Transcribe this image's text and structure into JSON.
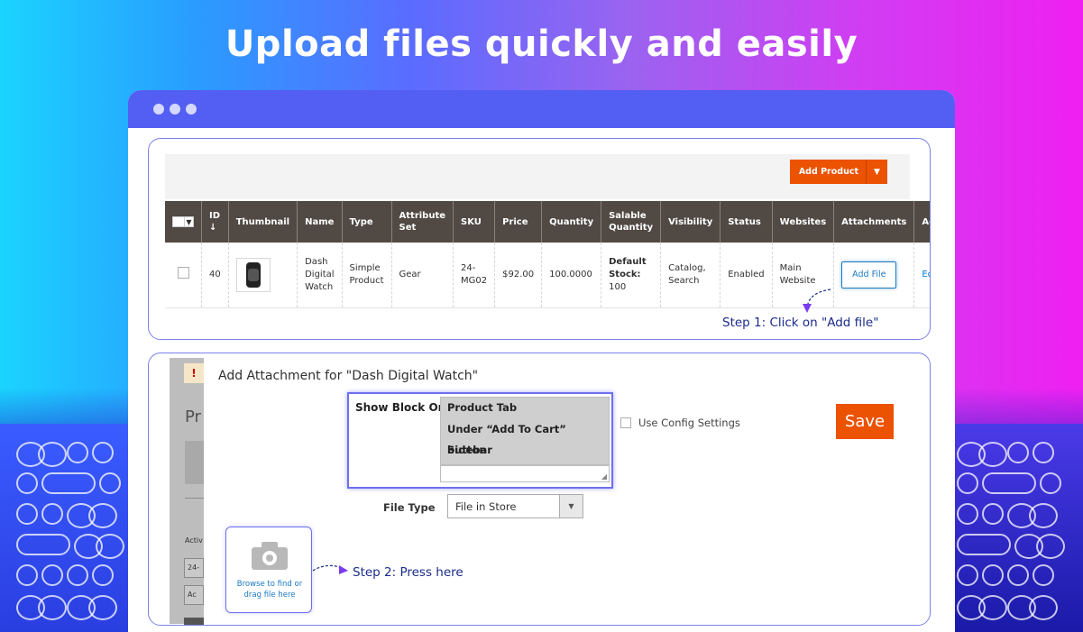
{
  "headline": "Upload files quickly and easily",
  "colors": {
    "accent": "#535ef2",
    "magento_orange": "#eb5202",
    "grid_header": "#514943",
    "step_text": "#1a2a8a"
  },
  "grid": {
    "add_product_label": "Add Product",
    "columns": [
      "ID ↓",
      "Thumbnail",
      "Name",
      "Type",
      "Attribute Set",
      "SKU",
      "Price",
      "Quantity",
      "Salable Quantity",
      "Visibility",
      "Status",
      "Websites",
      "Attachments",
      "Action"
    ],
    "row": {
      "id": "40",
      "name": "Dash Digital Watch",
      "type": "Simple Product",
      "attribute_set": "Gear",
      "sku": "24-MG02",
      "price": "$92.00",
      "quantity": "100.0000",
      "salable_label": "Default Stock:",
      "salable_value": "100",
      "visibility": "Catalog, Search",
      "status": "Enabled",
      "websites": "Main Website",
      "attachments_button": "Add File",
      "action": "Edit"
    },
    "step1": "Step 1: Click on \"Add file\""
  },
  "modal": {
    "bg_page_title": "Pr",
    "bg_label_active": "Activ",
    "bg_input_value": "24-",
    "bg_button": "Ac",
    "title": "Add Attachment for \"Dash Digital Watch\"",
    "show_block_label": "Show Block On",
    "show_block_options": [
      "Product Tab",
      "Under “Add To Cart” button",
      "Sidebar"
    ],
    "use_config_label": "Use Config Settings",
    "save_label": "Save",
    "file_type_label": "File Type",
    "file_type_value": "File in Store",
    "upload_text": "Browse to find or drag file here",
    "step2": "Step 2: Press here"
  }
}
